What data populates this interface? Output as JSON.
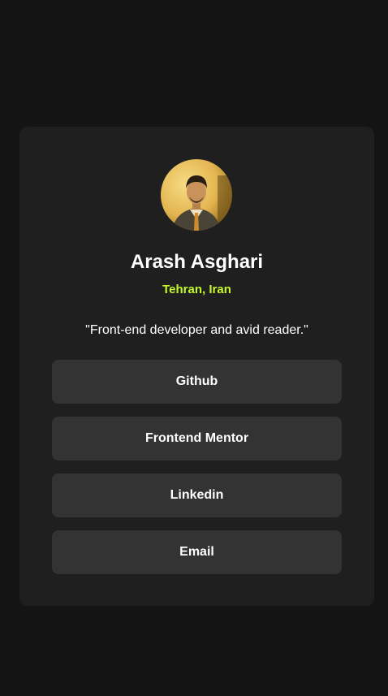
{
  "profile": {
    "name": "Arash Asghari",
    "location": "Tehran, Iran",
    "bio": "\"Front-end developer and avid reader.\""
  },
  "links": [
    {
      "label": "Github"
    },
    {
      "label": "Frontend Mentor"
    },
    {
      "label": "Linkedin"
    },
    {
      "label": "Email"
    }
  ],
  "colors": {
    "page_background": "#141414",
    "card_background": "#1f1f1f",
    "button_background": "#333333",
    "accent": "#c4f82a",
    "text": "#ffffff"
  }
}
